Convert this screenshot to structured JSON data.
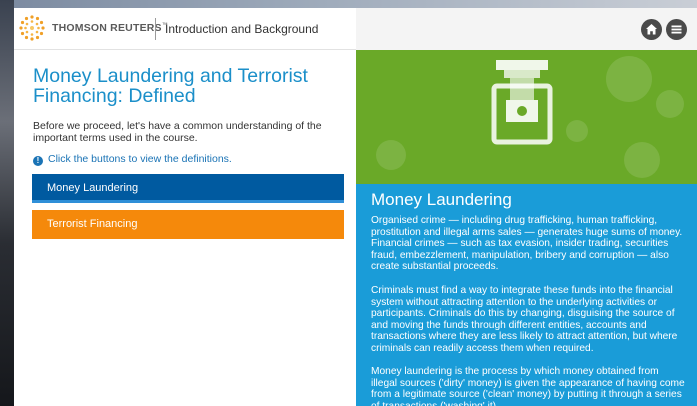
{
  "header": {
    "brand": "THOMSON REUTERS",
    "brand_mark": "™",
    "module_title": "Introduction and Background",
    "icons": {
      "home": "home-icon",
      "menu": "menu-icon"
    }
  },
  "left": {
    "title": "Money Laundering and Terrorist Financing: Defined",
    "intro": "Before we proceed, let's have a common understanding of the important terms used in the course.",
    "hint": "Click the buttons to view the definitions.",
    "buttons": [
      {
        "label": "Money Laundering",
        "selected": true
      },
      {
        "label": "Terrorist Financing",
        "selected": false
      }
    ]
  },
  "definition": {
    "title": "Money Laundering",
    "paragraphs": [
      "Organised crime — including drug trafficking, human trafficking, prostitution and illegal arms sales — generates huge sums of money. Financial crimes — such as tax evasion, insider trading, securities fraud, embezzlement, manipulation, bribery and corruption — also create substantial proceeds.",
      "Criminals must find a way to integrate these funds into the financial system without attracting attention to the underlying activities or participants. Criminals do this by changing, disguising the source of and moving the funds through different entities, accounts and transactions where they are less likely to attract attention, but where criminals can readily access them when required.",
      "Money laundering is the process by which money obtained from illegal sources ('dirty' money) is given the appearance of having come from a legitimate source ('clean' money) by putting it through a series of transactions ('washing' it)."
    ],
    "art_icon": "money-machine-icon"
  },
  "colors": {
    "title_blue": "#1b8fc9",
    "button_blue": "#005aa0",
    "button_orange": "#f5890b",
    "art_green": "#6aa928",
    "definition_blue": "#1a9cd8"
  }
}
